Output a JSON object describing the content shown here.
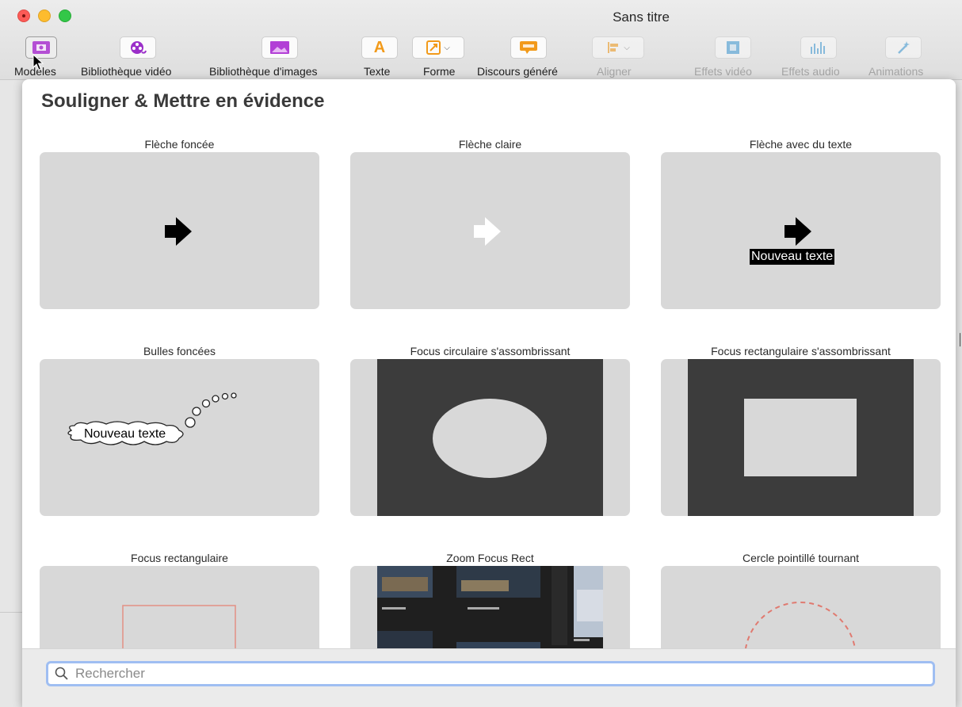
{
  "window": {
    "title": "Sans titre"
  },
  "toolbar": [
    {
      "label": "Modèles",
      "icon": "templates-icon",
      "enabled": true
    },
    {
      "label": "Bibliothèque vidéo",
      "icon": "video-library-icon",
      "enabled": true
    },
    {
      "label": "Bibliothèque d'images",
      "icon": "image-library-icon",
      "enabled": true
    },
    {
      "label": "Texte",
      "icon": "text-icon",
      "enabled": true
    },
    {
      "label": "Forme",
      "icon": "shape-icon",
      "enabled": true
    },
    {
      "label": "Discours généré",
      "icon": "generated-speech-icon",
      "enabled": true
    },
    {
      "label": "Aligner",
      "icon": "align-icon",
      "enabled": false
    },
    {
      "label": "Effets vidéo",
      "icon": "video-effects-icon",
      "enabled": false
    },
    {
      "label": "Effets audio",
      "icon": "audio-effects-icon",
      "enabled": false
    },
    {
      "label": "Animations",
      "icon": "animations-icon",
      "enabled": false
    }
  ],
  "panel": {
    "title": "Souligner & Mettre en évidence",
    "templates": [
      {
        "label": "Flèche foncée",
        "preview": "dark-arrow"
      },
      {
        "label": "Flèche claire",
        "preview": "light-arrow"
      },
      {
        "label": "Flèche avec du texte",
        "preview": "arrow-with-text",
        "preview_text": "Nouveau texte"
      },
      {
        "label": "Bulles foncées",
        "preview": "dark-bubbles",
        "preview_text": "Nouveau texte"
      },
      {
        "label": "Focus circulaire s'assombrissant",
        "preview": "circular-focus"
      },
      {
        "label": "Focus rectangulaire s'assombrissant",
        "preview": "rectangular-focus"
      },
      {
        "label": "Focus rectangulaire",
        "preview": "rectangle-outline"
      },
      {
        "label": "Zoom Focus Rect",
        "preview": "zoom-focus"
      },
      {
        "label": "Cercle pointillé tournant",
        "preview": "dotted-circle"
      }
    ]
  },
  "search": {
    "placeholder": "Rechercher",
    "value": ""
  },
  "colors": {
    "accent_purple": "#9b2fc9",
    "text_orange": "#f29a1a",
    "search_focus": "#9fbef2",
    "tile_bg": "#d8d8d8"
  }
}
